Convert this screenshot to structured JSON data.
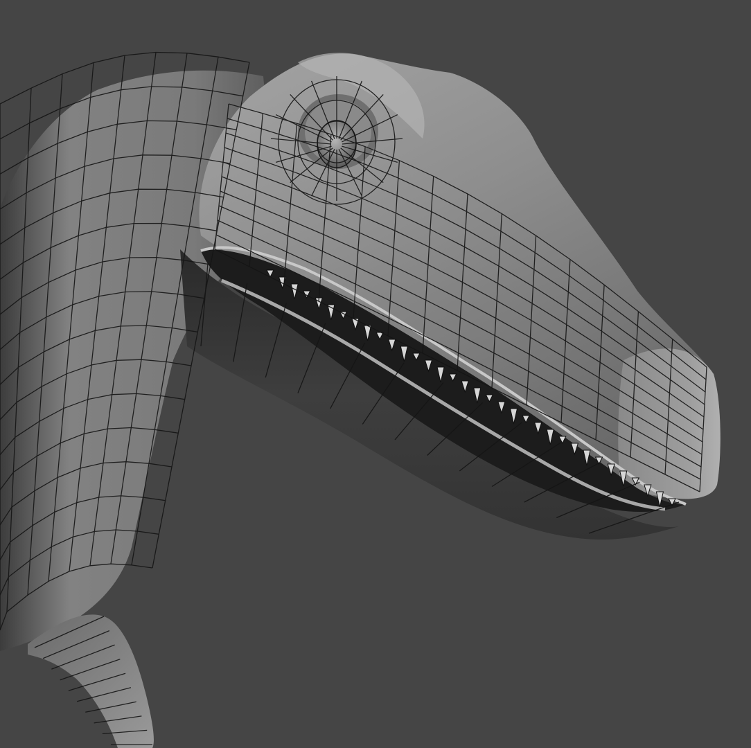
{
  "viewport": {
    "background": "#454545",
    "subject": "dinosaur-head-wireframe",
    "shading": "gray-solid-with-wireframe",
    "colors": {
      "skin_light": "#9c9c9c",
      "skin_mid": "#7a7a7a",
      "skin_dark": "#3a3a3a",
      "wire": "#1a1a1a",
      "mouth_inner": "#202020",
      "teeth": "#d8d8d8"
    }
  }
}
